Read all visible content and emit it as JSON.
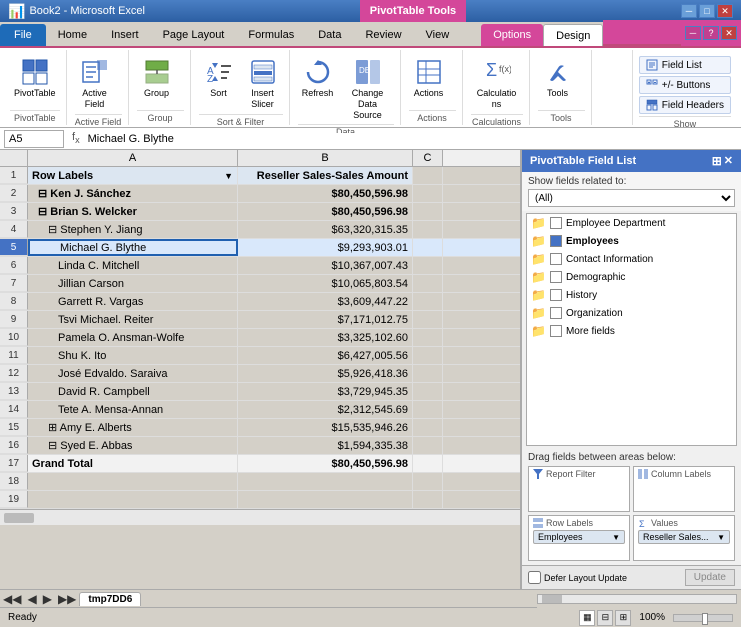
{
  "titleBar": {
    "title": "Book2 - Microsoft Excel",
    "pivotTools": "PivotTable Tools",
    "minBtn": "─",
    "maxBtn": "□",
    "closeBtn": "✕"
  },
  "ribbonTabs": {
    "file": "File",
    "home": "Home",
    "insert": "Insert",
    "pageLayout": "Page Layout",
    "formulas": "Formulas",
    "data": "Data",
    "review": "Review",
    "view": "View",
    "options": "Options",
    "design": "Design"
  },
  "ribbon": {
    "pivottable": "PivotTable",
    "activeField": "Active\nField",
    "group": "Group",
    "sortFilter": "Sort & Filter",
    "sort": "Sort",
    "insertSlicer": "Insert\nSlicer",
    "refresh": "Refresh",
    "changeDataSource": "Change Data\nSource",
    "dataGroup": "Data",
    "actions": "Actions",
    "calculations": "Calculations",
    "tools": "Tools",
    "fieldList": "Field List",
    "plusMinusButtons": "+/- Buttons",
    "fieldHeaders": "Field Headers",
    "showGroup": "Show"
  },
  "formulaBar": {
    "cellRef": "A5",
    "formula": "Michael G. Blythe"
  },
  "columns": {
    "A": "A",
    "B": "B",
    "C": "C"
  },
  "rows": [
    {
      "num": 1,
      "a": "Row Labels",
      "b": "Reseller Sales-Sales Amount",
      "c": "",
      "aClass": "header-cell dropdown-cell",
      "bClass": "header-cell right"
    },
    {
      "num": 2,
      "a": "⊟ Ken J. Sánchez",
      "b": "$80,450,596.98",
      "c": "",
      "aClass": "bold indent-1",
      "bClass": "bold right"
    },
    {
      "num": 3,
      "a": "⊟ Brian S. Welcker",
      "b": "$80,450,596.98",
      "c": "",
      "aClass": "bold indent-1",
      "bClass": "bold right"
    },
    {
      "num": 4,
      "a": "⊟ Stephen Y. Jiang",
      "b": "$63,320,315.35",
      "c": "",
      "aClass": "indent-2",
      "bClass": "right"
    },
    {
      "num": 5,
      "a": "Michael G. Blythe",
      "b": "$9,293,903.01",
      "c": "",
      "aClass": "indent-3 cell-active",
      "bClass": "right",
      "selected": true
    },
    {
      "num": 6,
      "a": "Linda C. Mitchell",
      "b": "$10,367,007.43",
      "c": "",
      "aClass": "indent-3",
      "bClass": "right"
    },
    {
      "num": 7,
      "a": "Jillian Carson",
      "b": "$10,065,803.54",
      "c": "",
      "aClass": "indent-3",
      "bClass": "right"
    },
    {
      "num": 8,
      "a": "Garrett R. Vargas",
      "b": "$3,609,447.22",
      "c": "",
      "aClass": "indent-3",
      "bClass": "right"
    },
    {
      "num": 9,
      "a": "Tsvi Michael. Reiter",
      "b": "$7,171,012.75",
      "c": "",
      "aClass": "indent-3",
      "bClass": "right"
    },
    {
      "num": 10,
      "a": "Pamela O. Ansman-Wolfe",
      "b": "$3,325,102.60",
      "c": "",
      "aClass": "indent-3",
      "bClass": "right"
    },
    {
      "num": 11,
      "a": "Shu K. Ito",
      "b": "$6,427,005.56",
      "c": "",
      "aClass": "indent-3",
      "bClass": "right"
    },
    {
      "num": 12,
      "a": "José Edvaldo. Saraiva",
      "b": "$5,926,418.36",
      "c": "",
      "aClass": "indent-3",
      "bClass": "right"
    },
    {
      "num": 13,
      "a": "David R. Campbell",
      "b": "$3,729,945.35",
      "c": "",
      "aClass": "indent-3",
      "bClass": "right"
    },
    {
      "num": 14,
      "a": "Tete A. Mensa-Annan",
      "b": "$2,312,545.69",
      "c": "",
      "aClass": "indent-3",
      "bClass": "right"
    },
    {
      "num": 15,
      "a": "⊞ Amy E. Alberts",
      "b": "$15,535,946.26",
      "c": "",
      "aClass": "indent-2",
      "bClass": "right"
    },
    {
      "num": 16,
      "a": "⊟ Syed E. Abbas",
      "b": "$1,594,335.38",
      "c": "",
      "aClass": "indent-2",
      "bClass": "right"
    },
    {
      "num": 17,
      "a": "Grand Total",
      "b": "$80,450,596.98",
      "c": "",
      "aClass": "bold",
      "bClass": "bold right"
    },
    {
      "num": 18,
      "a": "",
      "b": "",
      "c": ""
    },
    {
      "num": 19,
      "a": "",
      "b": "",
      "c": ""
    }
  ],
  "sheetTabs": {
    "active": "tmp7DD6"
  },
  "statusBar": {
    "status": "Ready"
  },
  "pivotPanel": {
    "title": "PivotTable Field List",
    "showFieldsLabel": "Show fields related to:",
    "showFieldsValue": "(All)",
    "fields": [
      {
        "name": "Employee Department",
        "type": "folder",
        "checked": false
      },
      {
        "name": "Employees",
        "type": "folder",
        "checked": true,
        "bold": true
      },
      {
        "name": "Contact Information",
        "type": "folder",
        "checked": false
      },
      {
        "name": "Demographic",
        "type": "folder",
        "checked": false
      },
      {
        "name": "History",
        "type": "folder",
        "checked": false
      },
      {
        "name": "Organization",
        "type": "folder",
        "checked": false
      },
      {
        "name": "More fields",
        "type": "folder",
        "checked": false
      }
    ],
    "dragLabel": "Drag fields between areas below:",
    "reportFilterLabel": "Report Filter",
    "columnLabelsLabel": "Column Labels",
    "rowLabelsLabel": "Row Labels",
    "valuesLabel": "Values",
    "rowLabelsTag": "Employees",
    "valuesTag": "Reseller Sales...",
    "deferLabel": "Defer Layout Update",
    "updateBtn": "Update"
  }
}
